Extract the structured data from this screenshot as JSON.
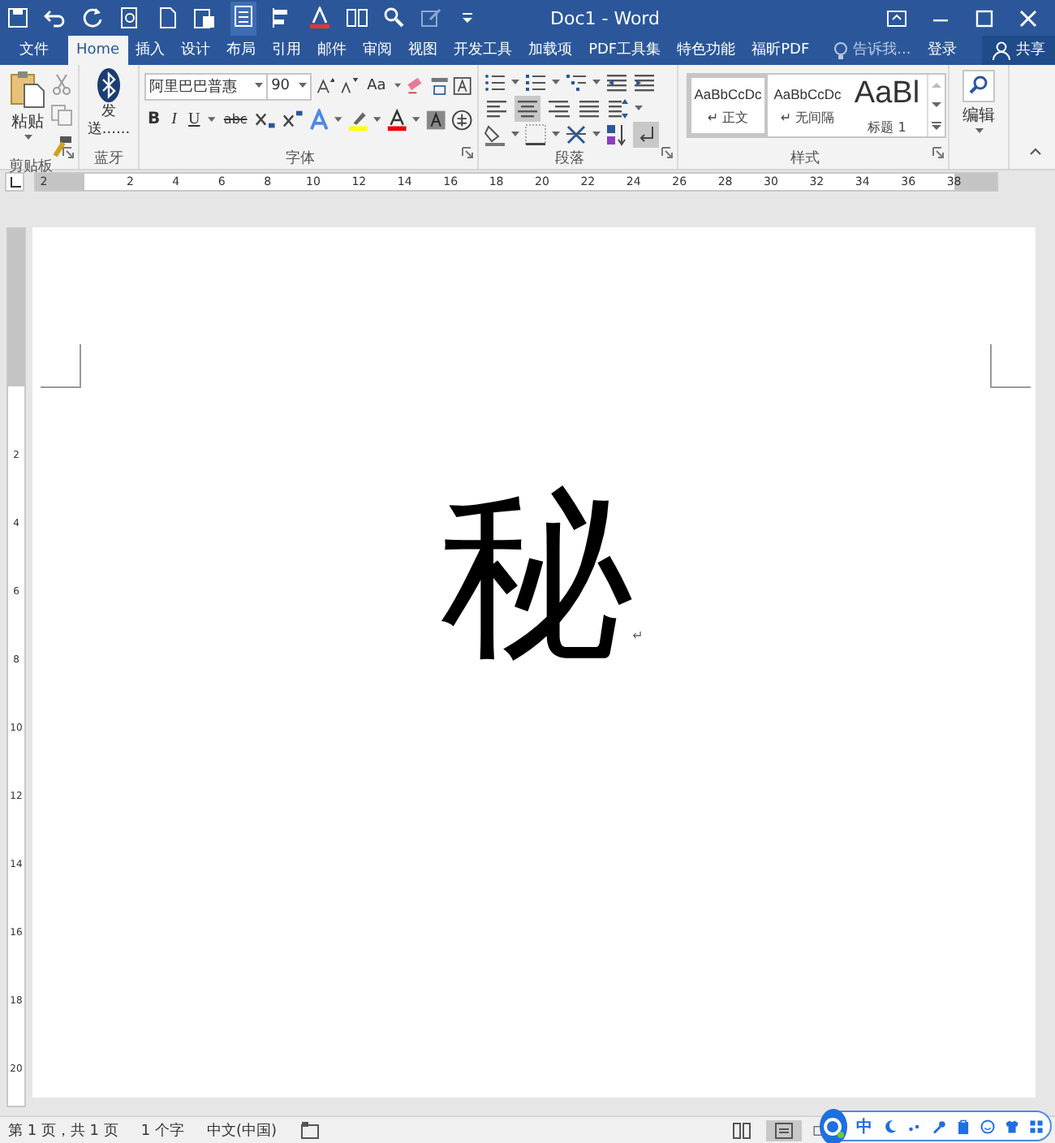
{
  "window": {
    "title": "Doc1 - Word"
  },
  "tabs": [
    {
      "label": "文件",
      "kind": "file",
      "selected": false
    },
    {
      "label": "Home",
      "kind": "tab",
      "selected": true
    },
    {
      "label": "插入",
      "kind": "tab",
      "selected": false
    },
    {
      "label": "设计",
      "kind": "tab",
      "selected": false
    },
    {
      "label": "布局",
      "kind": "tab",
      "selected": false
    },
    {
      "label": "引用",
      "kind": "tab",
      "selected": false
    },
    {
      "label": "邮件",
      "kind": "tab",
      "selected": false
    },
    {
      "label": "审阅",
      "kind": "tab",
      "selected": false
    },
    {
      "label": "视图",
      "kind": "tab",
      "selected": false
    },
    {
      "label": "开发工具",
      "kind": "tab",
      "selected": false
    },
    {
      "label": "加载项",
      "kind": "tab",
      "selected": false
    },
    {
      "label": "PDF工具集",
      "kind": "tab",
      "selected": false
    },
    {
      "label": "特色功能",
      "kind": "tab",
      "selected": false
    },
    {
      "label": "福昕PDF",
      "kind": "tab",
      "selected": false
    }
  ],
  "tell_me": {
    "placeholder": "告诉我..."
  },
  "sign_in": "登录",
  "share": "共享",
  "ribbon": {
    "clipboard": {
      "paste": "粘贴",
      "group": "剪贴板"
    },
    "bluetooth": {
      "send": "发送......",
      "group": "蓝牙"
    },
    "font": {
      "font_name": "阿里巴巴普惠",
      "font_size": "90",
      "case": "Aa",
      "bold": "B",
      "italic": "I",
      "underline": "U",
      "strike": "abc",
      "group": "字体"
    },
    "paragraph": {
      "align_buttons": [
        {
          "selected": false
        },
        {
          "selected": true
        },
        {
          "selected": false
        },
        {
          "selected": false
        }
      ],
      "show_marks": {
        "selected": true
      },
      "group": "段落"
    },
    "styles": {
      "items": [
        {
          "preview": "AaBbCcDc",
          "label": "↵ 正文",
          "kind": "small",
          "selected": true
        },
        {
          "preview": "AaBbCcDc",
          "label": "↵ 无间隔",
          "kind": "small",
          "selected": false
        },
        {
          "preview": "AaBl",
          "label": "标题 1",
          "kind": "large",
          "selected": false
        }
      ],
      "group": "样式"
    },
    "editing": {
      "label": "编辑"
    }
  },
  "ruler": {
    "left_number": "2",
    "numbers": [
      "2",
      "4",
      "6",
      "8",
      "10",
      "12",
      "14",
      "16",
      "18",
      "20",
      "22",
      "24",
      "26",
      "28",
      "30",
      "32",
      "34",
      "36",
      "38"
    ]
  },
  "vertical_ruler": {
    "numbers": [
      "2",
      "4",
      "6",
      "8",
      "10",
      "12",
      "14",
      "16",
      "18",
      "20"
    ]
  },
  "document": {
    "text": "秘",
    "paragraph_mark": "↵"
  },
  "status_bar": {
    "page": "第 1 页，共 1 页",
    "words": "1 个字",
    "language": "中文(中国)",
    "views": [
      {
        "selected": false
      },
      {
        "selected": true
      },
      {
        "selected": false
      }
    ]
  },
  "ime_toolbar": {
    "mode": "中"
  }
}
